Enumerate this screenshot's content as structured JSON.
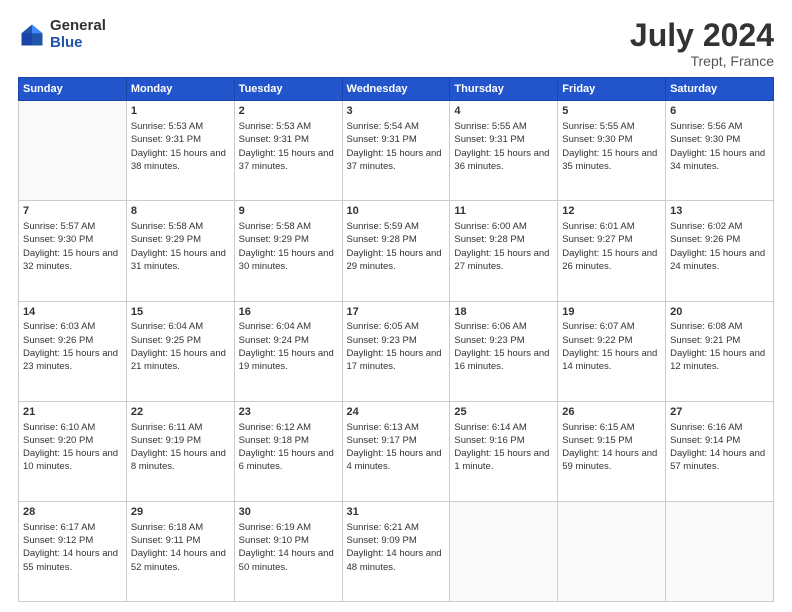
{
  "header": {
    "logo_general": "General",
    "logo_blue": "Blue",
    "main_title": "July 2024",
    "subtitle": "Trept, France"
  },
  "days_of_week": [
    "Sunday",
    "Monday",
    "Tuesday",
    "Wednesday",
    "Thursday",
    "Friday",
    "Saturday"
  ],
  "weeks": [
    [
      {
        "num": "",
        "sunrise": "",
        "sunset": "",
        "daylight": ""
      },
      {
        "num": "1",
        "sunrise": "Sunrise: 5:53 AM",
        "sunset": "Sunset: 9:31 PM",
        "daylight": "Daylight: 15 hours and 38 minutes."
      },
      {
        "num": "2",
        "sunrise": "Sunrise: 5:53 AM",
        "sunset": "Sunset: 9:31 PM",
        "daylight": "Daylight: 15 hours and 37 minutes."
      },
      {
        "num": "3",
        "sunrise": "Sunrise: 5:54 AM",
        "sunset": "Sunset: 9:31 PM",
        "daylight": "Daylight: 15 hours and 37 minutes."
      },
      {
        "num": "4",
        "sunrise": "Sunrise: 5:55 AM",
        "sunset": "Sunset: 9:31 PM",
        "daylight": "Daylight: 15 hours and 36 minutes."
      },
      {
        "num": "5",
        "sunrise": "Sunrise: 5:55 AM",
        "sunset": "Sunset: 9:30 PM",
        "daylight": "Daylight: 15 hours and 35 minutes."
      },
      {
        "num": "6",
        "sunrise": "Sunrise: 5:56 AM",
        "sunset": "Sunset: 9:30 PM",
        "daylight": "Daylight: 15 hours and 34 minutes."
      }
    ],
    [
      {
        "num": "7",
        "sunrise": "Sunrise: 5:57 AM",
        "sunset": "Sunset: 9:30 PM",
        "daylight": "Daylight: 15 hours and 32 minutes."
      },
      {
        "num": "8",
        "sunrise": "Sunrise: 5:58 AM",
        "sunset": "Sunset: 9:29 PM",
        "daylight": "Daylight: 15 hours and 31 minutes."
      },
      {
        "num": "9",
        "sunrise": "Sunrise: 5:58 AM",
        "sunset": "Sunset: 9:29 PM",
        "daylight": "Daylight: 15 hours and 30 minutes."
      },
      {
        "num": "10",
        "sunrise": "Sunrise: 5:59 AM",
        "sunset": "Sunset: 9:28 PM",
        "daylight": "Daylight: 15 hours and 29 minutes."
      },
      {
        "num": "11",
        "sunrise": "Sunrise: 6:00 AM",
        "sunset": "Sunset: 9:28 PM",
        "daylight": "Daylight: 15 hours and 27 minutes."
      },
      {
        "num": "12",
        "sunrise": "Sunrise: 6:01 AM",
        "sunset": "Sunset: 9:27 PM",
        "daylight": "Daylight: 15 hours and 26 minutes."
      },
      {
        "num": "13",
        "sunrise": "Sunrise: 6:02 AM",
        "sunset": "Sunset: 9:26 PM",
        "daylight": "Daylight: 15 hours and 24 minutes."
      }
    ],
    [
      {
        "num": "14",
        "sunrise": "Sunrise: 6:03 AM",
        "sunset": "Sunset: 9:26 PM",
        "daylight": "Daylight: 15 hours and 23 minutes."
      },
      {
        "num": "15",
        "sunrise": "Sunrise: 6:04 AM",
        "sunset": "Sunset: 9:25 PM",
        "daylight": "Daylight: 15 hours and 21 minutes."
      },
      {
        "num": "16",
        "sunrise": "Sunrise: 6:04 AM",
        "sunset": "Sunset: 9:24 PM",
        "daylight": "Daylight: 15 hours and 19 minutes."
      },
      {
        "num": "17",
        "sunrise": "Sunrise: 6:05 AM",
        "sunset": "Sunset: 9:23 PM",
        "daylight": "Daylight: 15 hours and 17 minutes."
      },
      {
        "num": "18",
        "sunrise": "Sunrise: 6:06 AM",
        "sunset": "Sunset: 9:23 PM",
        "daylight": "Daylight: 15 hours and 16 minutes."
      },
      {
        "num": "19",
        "sunrise": "Sunrise: 6:07 AM",
        "sunset": "Sunset: 9:22 PM",
        "daylight": "Daylight: 15 hours and 14 minutes."
      },
      {
        "num": "20",
        "sunrise": "Sunrise: 6:08 AM",
        "sunset": "Sunset: 9:21 PM",
        "daylight": "Daylight: 15 hours and 12 minutes."
      }
    ],
    [
      {
        "num": "21",
        "sunrise": "Sunrise: 6:10 AM",
        "sunset": "Sunset: 9:20 PM",
        "daylight": "Daylight: 15 hours and 10 minutes."
      },
      {
        "num": "22",
        "sunrise": "Sunrise: 6:11 AM",
        "sunset": "Sunset: 9:19 PM",
        "daylight": "Daylight: 15 hours and 8 minutes."
      },
      {
        "num": "23",
        "sunrise": "Sunrise: 6:12 AM",
        "sunset": "Sunset: 9:18 PM",
        "daylight": "Daylight: 15 hours and 6 minutes."
      },
      {
        "num": "24",
        "sunrise": "Sunrise: 6:13 AM",
        "sunset": "Sunset: 9:17 PM",
        "daylight": "Daylight: 15 hours and 4 minutes."
      },
      {
        "num": "25",
        "sunrise": "Sunrise: 6:14 AM",
        "sunset": "Sunset: 9:16 PM",
        "daylight": "Daylight: 15 hours and 1 minute."
      },
      {
        "num": "26",
        "sunrise": "Sunrise: 6:15 AM",
        "sunset": "Sunset: 9:15 PM",
        "daylight": "Daylight: 14 hours and 59 minutes."
      },
      {
        "num": "27",
        "sunrise": "Sunrise: 6:16 AM",
        "sunset": "Sunset: 9:14 PM",
        "daylight": "Daylight: 14 hours and 57 minutes."
      }
    ],
    [
      {
        "num": "28",
        "sunrise": "Sunrise: 6:17 AM",
        "sunset": "Sunset: 9:12 PM",
        "daylight": "Daylight: 14 hours and 55 minutes."
      },
      {
        "num": "29",
        "sunrise": "Sunrise: 6:18 AM",
        "sunset": "Sunset: 9:11 PM",
        "daylight": "Daylight: 14 hours and 52 minutes."
      },
      {
        "num": "30",
        "sunrise": "Sunrise: 6:19 AM",
        "sunset": "Sunset: 9:10 PM",
        "daylight": "Daylight: 14 hours and 50 minutes."
      },
      {
        "num": "31",
        "sunrise": "Sunrise: 6:21 AM",
        "sunset": "Sunset: 9:09 PM",
        "daylight": "Daylight: 14 hours and 48 minutes."
      },
      {
        "num": "",
        "sunrise": "",
        "sunset": "",
        "daylight": ""
      },
      {
        "num": "",
        "sunrise": "",
        "sunset": "",
        "daylight": ""
      },
      {
        "num": "",
        "sunrise": "",
        "sunset": "",
        "daylight": ""
      }
    ]
  ]
}
